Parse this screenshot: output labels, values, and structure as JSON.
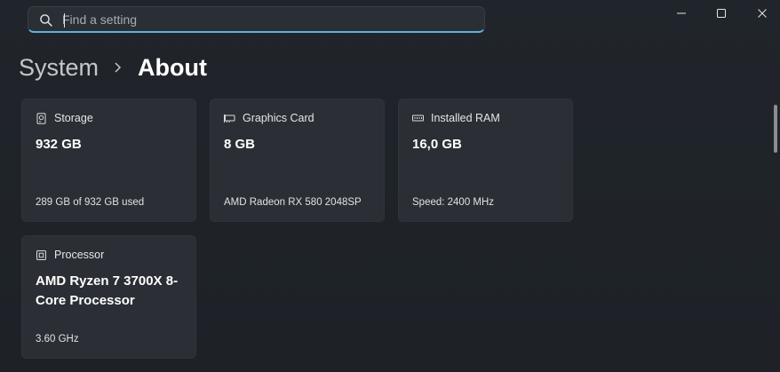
{
  "search": {
    "placeholder": "Find a setting"
  },
  "window_controls": {
    "minimize_icon": "minimize-icon",
    "maximize_icon": "maximize-icon",
    "close_icon": "close-icon"
  },
  "breadcrumb": {
    "parent": "System",
    "current": "About"
  },
  "cards": [
    {
      "icon": "storage-icon",
      "label": "Storage",
      "value": "932 GB",
      "detail": "289 GB of 932 GB used"
    },
    {
      "icon": "graphics-card-icon",
      "label": "Graphics Card",
      "value": "8 GB",
      "detail": "AMD Radeon RX 580 2048SP"
    },
    {
      "icon": "ram-icon",
      "label": "Installed RAM",
      "value": "16,0 GB",
      "detail": "Speed: 2400 MHz"
    },
    {
      "icon": "processor-icon",
      "label": "Processor",
      "value": "AMD Ryzen 7 3700X 8-Core Processor",
      "detail": "3.60 GHz"
    }
  ],
  "colors": {
    "background": "#1f2329",
    "card": "#2b2f35",
    "accent": "#5fb3d9"
  }
}
